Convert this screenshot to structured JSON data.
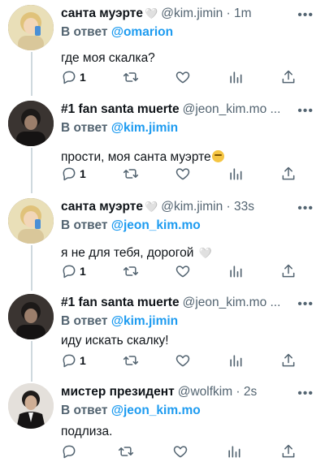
{
  "tweets": [
    {
      "display_name": "санта муэрте",
      "name_suffix": "🤍",
      "handle": "@kim.jimin · 1m",
      "reply_prefix": "В ответ",
      "reply_to": "@omarion",
      "text": "где моя скалка?",
      "reply_count": "1",
      "avatar": "avatar-blonde-yellow"
    },
    {
      "display_name": "#1 fan santa muerte",
      "name_suffix": "",
      "handle": "@jeon_kim.mo ...",
      "reply_prefix": "В ответ",
      "reply_to": "@kim.jimin",
      "text": "прости, моя санта муэрте",
      "text_emoji": "😭",
      "reply_count": "1",
      "avatar": "avatar-dark"
    },
    {
      "display_name": "санта муэрте",
      "name_suffix": "🤍",
      "handle": "@kim.jimin · 33s",
      "reply_prefix": "В ответ",
      "reply_to": "@jeon_kim.mo",
      "text": "я не для тебя, дорогой",
      "text_emoji": "🤍",
      "reply_count": "1",
      "avatar": "avatar-blonde-yellow"
    },
    {
      "display_name": "#1 fan santa muerte",
      "name_suffix": "",
      "handle": "@jeon_kim.mo ...",
      "reply_prefix": "В ответ",
      "reply_to": "@kim.jimin",
      "text": "иду искать скалку!",
      "reply_count": "1",
      "avatar": "avatar-dark"
    },
    {
      "display_name": "мистер президент",
      "name_suffix": "",
      "handle": "@wolfkim · 2s",
      "reply_prefix": "В ответ",
      "reply_to": "@jeon_kim.mo",
      "text": "подлиза.",
      "reply_count": "",
      "avatar": "avatar-suit"
    }
  ],
  "icons": {
    "more": "more-icon",
    "reply": "reply-icon",
    "retweet": "retweet-icon",
    "like": "like-icon",
    "analytics": "analytics-icon",
    "share": "share-icon"
  },
  "colors": {
    "mention": "#1d9bf0",
    "secondary_text": "#536471",
    "thread_line": "#cfd9de"
  }
}
